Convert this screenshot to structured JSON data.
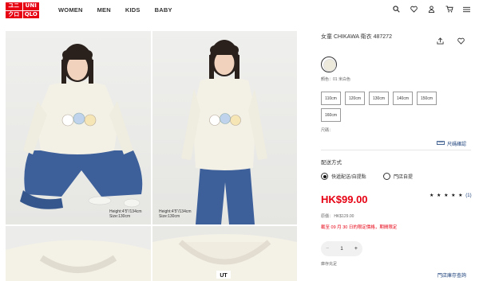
{
  "header": {
    "logo": [
      "ユニ",
      "UNI",
      "クロ",
      "QLO"
    ],
    "nav": [
      "WOMEN",
      "MEN",
      "KIDS",
      "BABY"
    ],
    "icons": [
      "search-icon",
      "heart-icon",
      "user-icon",
      "cart-icon",
      "menu-icon"
    ]
  },
  "gallery": {
    "captions": [
      {
        "height": "Height:4'5\"/134cm",
        "size": "Size:130cm"
      },
      {
        "height": "Height:4'5\"/134cm",
        "size": "Size:130cm"
      }
    ]
  },
  "product": {
    "title": "女童 CHIKAWA 衛衣 487272",
    "color_label": "顏色：01 米白色",
    "sizes": [
      "110cm",
      "120cm",
      "130cm",
      "140cm",
      "150cm",
      "160cm"
    ],
    "size_label": "尺碼：",
    "size_guide": "尺碼確認",
    "delivery_title": "配送方式",
    "delivery_options": [
      "快遞配送/自提點",
      "門店自提"
    ],
    "price": "HK$99.00",
    "rating_stars": "★ ★ ★ ★ ★",
    "rating_count": "(1)",
    "original_price": "原價： HK$129.00",
    "promo": "截至 09 月 30 日的限定價格，期間限定",
    "quantity": "1",
    "stock_label": "庫存充足",
    "store_stock_link": "門店庫存查詢"
  },
  "colors": {
    "accent": "#e60012",
    "link": "#1a3f7a",
    "swatch": "#eeeadb"
  }
}
